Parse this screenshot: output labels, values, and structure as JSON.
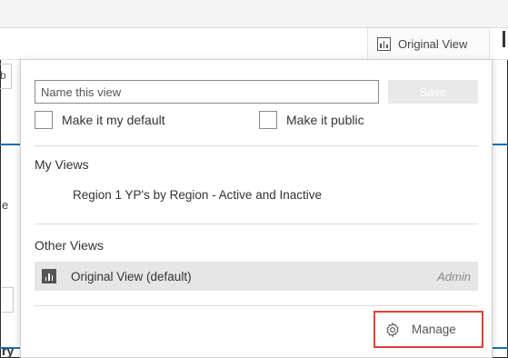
{
  "toolbar": {
    "original_view_label": "Original View",
    "left_peek_letter": "b",
    "left_peek_letter_2": "e",
    "left_peek_letter_3": "ry"
  },
  "dropdown": {
    "name_placeholder": "Name this view",
    "save_label": "Save",
    "default_checkbox_label": "Make it my default",
    "public_checkbox_label": "Make it public",
    "my_views_title": "My Views",
    "my_views": [
      {
        "label": "Region 1 YP's by Region - Active and Inactive"
      }
    ],
    "other_views_title": "Other Views",
    "other_views": [
      {
        "label": "Original View (default)",
        "owner": "Admin"
      }
    ],
    "manage_label": "Manage"
  },
  "colors": {
    "accent_blue": "#1f6fb2",
    "highlight_red": "#e0403a",
    "selected_row_bg": "#e6e6e6"
  }
}
